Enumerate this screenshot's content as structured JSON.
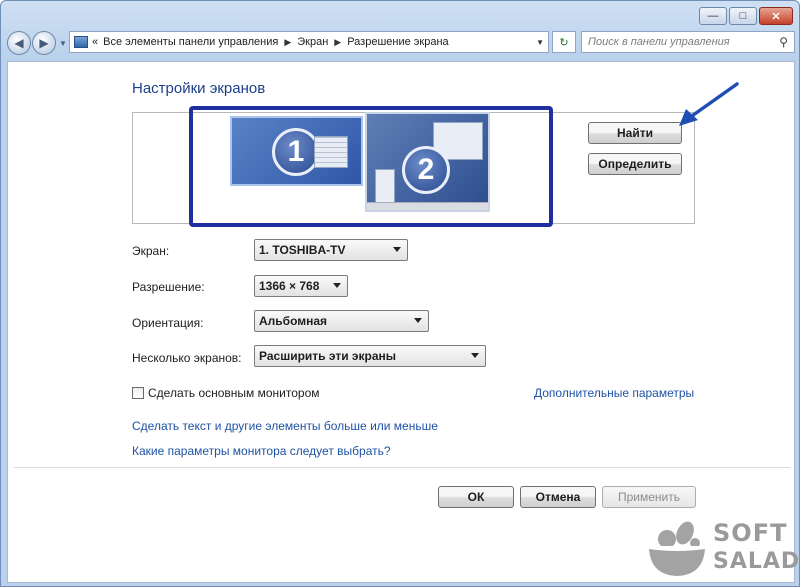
{
  "titlebar": {
    "minimize": "—",
    "maximize": "□",
    "close": "✕"
  },
  "navbar": {
    "back": "◀",
    "forward": "▶",
    "breadcrumbs": [
      "«",
      "Все элементы панели управления",
      "Экран",
      "Разрешение экрана"
    ],
    "refresh": "↻",
    "search_placeholder": "Поиск в панели управления"
  },
  "page": {
    "title": "Настройки экранов",
    "monitors": [
      {
        "number": "1"
      },
      {
        "number": "2"
      }
    ],
    "find_button": "Найти",
    "identify_button": "Определить"
  },
  "settings": {
    "display_label": "Экран:",
    "display_value": "1. TOSHIBA-TV",
    "resolution_label": "Разрешение:",
    "resolution_value": "1366 × 768",
    "orientation_label": "Ориентация:",
    "orientation_value": "Альбомная",
    "multi_label": "Несколько экранов:",
    "multi_value": "Расширить эти экраны"
  },
  "primary_monitor": {
    "label": "Сделать основным монитором",
    "checked": false
  },
  "links": {
    "advanced": "Дополнительные параметры",
    "text_size": "Сделать текст и другие элементы больше или меньше",
    "which_settings": "Какие параметры монитора следует выбрать?"
  },
  "footer": {
    "ok": "ОК",
    "cancel": "Отмена",
    "apply": "Применить"
  },
  "watermark": {
    "line1": "SOFT",
    "line2": "SALAD"
  },
  "colors": {
    "highlight_frame": "#1f2fa0",
    "link": "#1f53a5",
    "title": "#1e3f8a",
    "arrow": "#1f4fb5"
  }
}
